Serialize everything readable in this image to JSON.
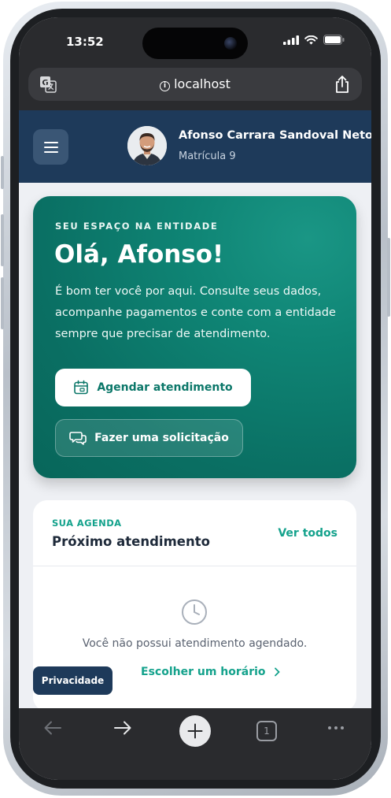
{
  "status_bar": {
    "time": "13:52"
  },
  "browser": {
    "url": "localhost",
    "info_glyph": "i",
    "icons": [
      "translate-icon",
      "share-icon"
    ],
    "tab_count": "1"
  },
  "header": {
    "user_name": "Afonso Carrara Sandoval Neto",
    "registration": "Matrícula 9"
  },
  "hero": {
    "eyebrow": "SEU ESPAÇO NA ENTIDADE",
    "title": "Olá, Afonso!",
    "text": "É bom ter você por aqui. Consulte seus dados, acompanhe pagamentos e conte com a entidade sempre que precisar de atendimento.",
    "primary_button": "Agendar atendimento",
    "secondary_button": "Fazer uma solicitação"
  },
  "agenda": {
    "eyebrow": "SUA AGENDA",
    "title": "Próximo atendimento",
    "see_all": "Ver todos",
    "empty_message": "Você não possui atendimento agendado.",
    "choose_link": "Escolher um horário"
  },
  "privacy_button": "Privacidade",
  "colors": {
    "header_navy": "#1e3a5a",
    "accent_teal": "#14a28c",
    "hero_teal": "#0f8575"
  }
}
